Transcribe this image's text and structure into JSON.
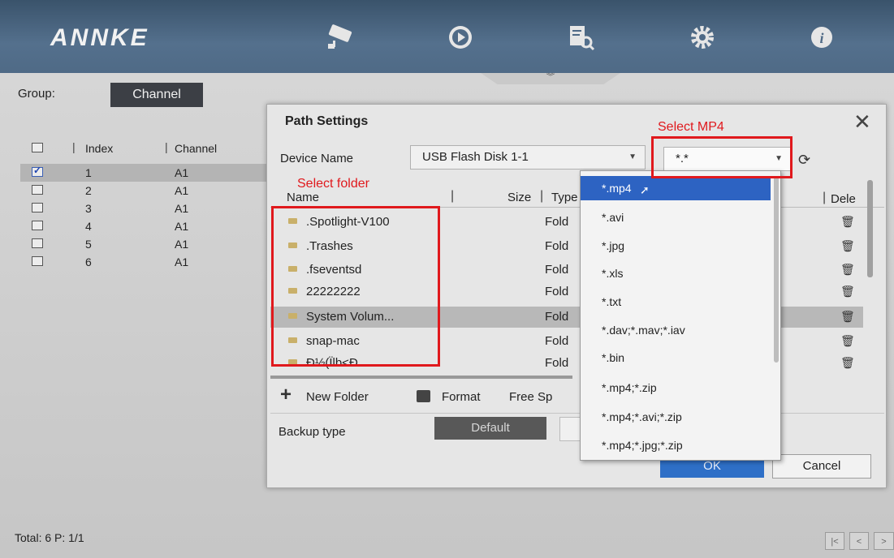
{
  "brand": "ANNKE",
  "nav_icons": [
    "camera-icon",
    "playback-icon",
    "search-icon",
    "gear-icon",
    "info-icon"
  ],
  "group": {
    "label": "Group:",
    "value": "Channel"
  },
  "channel_table": {
    "columns": [
      "Index",
      "Channel"
    ],
    "rows": [
      {
        "index": "1",
        "channel": "A1",
        "checked": true
      },
      {
        "index": "2",
        "channel": "A1",
        "checked": false
      },
      {
        "index": "3",
        "channel": "A1",
        "checked": false
      },
      {
        "index": "4",
        "channel": "A1",
        "checked": false
      },
      {
        "index": "5",
        "channel": "A1",
        "checked": false
      },
      {
        "index": "6",
        "channel": "A1",
        "checked": false
      }
    ]
  },
  "footer": {
    "total": "Total: 6 P: 1/1"
  },
  "dialog": {
    "title": "Path Settings",
    "device_label": "Device Name",
    "device_value": "USB Flash Disk 1-1",
    "filter_value": "*.*",
    "columns": {
      "name": "Name",
      "size": "Size",
      "type": "Type",
      "delete": "Dele"
    },
    "files": [
      {
        "name": ".Spotlight-V100",
        "type": "Fold"
      },
      {
        "name": ".Trashes",
        "type": "Fold"
      },
      {
        "name": ".fseventsd",
        "type": "Fold"
      },
      {
        "name": "22222222",
        "type": "Fold"
      },
      {
        "name": "System Volum...",
        "type": "Fold",
        "selected": true
      },
      {
        "name": "snap-mac",
        "type": "Fold"
      },
      {
        "name": "Đ½(Ïlb<Đ",
        "type": "Fold"
      }
    ],
    "new_folder": "New Folder",
    "format": "Format",
    "free_space": "Free Sp",
    "backup_type_label": "Backup type",
    "backup_default": "Default",
    "ok": "OK",
    "cancel": "Cancel"
  },
  "filter_options": [
    "*.mp4",
    "*.avi",
    "*.jpg",
    "*.xls",
    "*.txt",
    "*.dav;*.mav;*.iav",
    "*.bin",
    "*.mp4;*.zip",
    "*.mp4;*.avi;*.zip",
    "*.mp4;*.jpg;*.zip"
  ],
  "annotations": {
    "select_mp4": "Select MP4",
    "select_folder": "Select folder"
  },
  "colors": {
    "accent_blue": "#2d63c2",
    "annotation_red": "#e0191d",
    "topbar": "#4f6a86"
  }
}
